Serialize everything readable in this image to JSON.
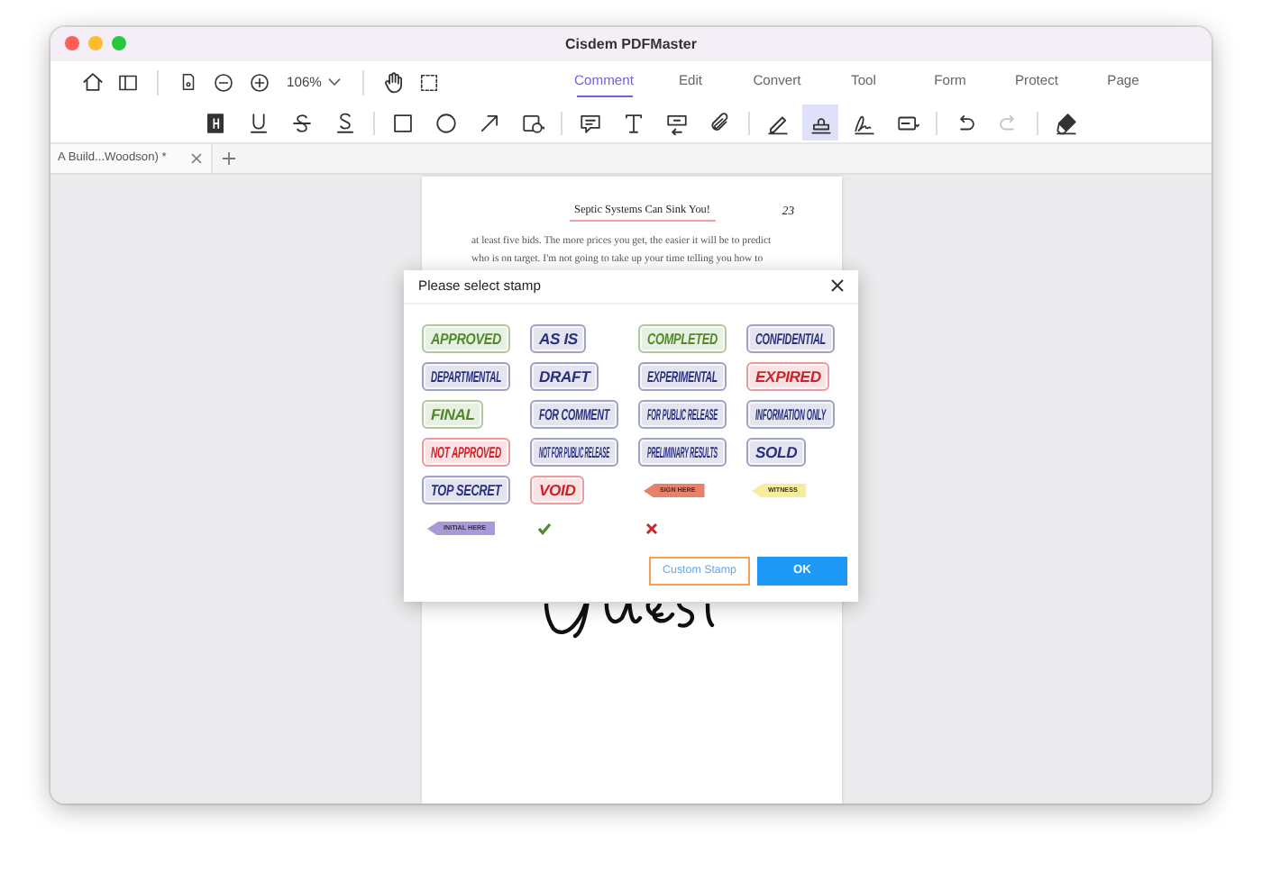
{
  "window": {
    "title": "Cisdem PDFMaster"
  },
  "toolbar": {
    "zoom": "106%",
    "tabs": [
      {
        "label": "Comment",
        "selected": true
      },
      {
        "label": "Edit",
        "selected": false
      },
      {
        "label": "Convert",
        "selected": false
      },
      {
        "label": "Tool",
        "selected": false
      },
      {
        "label": "Form",
        "selected": false
      },
      {
        "label": "Protect",
        "selected": false
      },
      {
        "label": "Page",
        "selected": false
      }
    ]
  },
  "annotation_tools": [
    [
      {
        "kind": "highlight",
        "selected": false,
        "disabled": false
      },
      {
        "kind": "underline",
        "selected": false,
        "disabled": false
      },
      {
        "kind": "strikethrough",
        "selected": false,
        "disabled": false
      },
      {
        "kind": "squiggly",
        "selected": false,
        "disabled": false
      }
    ],
    [
      {
        "kind": "rectangle",
        "selected": false,
        "disabled": false
      },
      {
        "kind": "circle",
        "selected": false,
        "disabled": false
      },
      {
        "kind": "arrow",
        "selected": false,
        "disabled": false
      },
      {
        "kind": "shape",
        "selected": false,
        "disabled": false
      }
    ],
    [
      {
        "kind": "note",
        "selected": false,
        "disabled": false
      },
      {
        "kind": "text",
        "selected": false,
        "disabled": false
      },
      {
        "kind": "textbox",
        "selected": false,
        "disabled": false
      },
      {
        "kind": "attachment",
        "selected": false,
        "disabled": false
      }
    ],
    [
      {
        "kind": "pen",
        "selected": false,
        "disabled": false
      },
      {
        "kind": "stamp",
        "selected": true,
        "disabled": false
      },
      {
        "kind": "signature",
        "selected": false,
        "disabled": false
      },
      {
        "kind": "field",
        "selected": false,
        "disabled": false
      }
    ],
    [
      {
        "kind": "undo",
        "selected": false,
        "disabled": false
      },
      {
        "kind": "redo",
        "selected": false,
        "disabled": true
      }
    ],
    [
      {
        "kind": "eraser",
        "selected": false,
        "disabled": false
      }
    ]
  ],
  "document_tabs": [
    {
      "label": "A Build...Woodson) *"
    }
  ],
  "page": {
    "header": "Septic Systems Can Sink You!",
    "page_number": "23",
    "lines": [
      "at least five bids. The more prices you get, the easier it will be to predict",
      "who is on target. I'm not going to take up your time telling you how to"
    ]
  },
  "dialog": {
    "title": "Please select stamp",
    "stamps": [
      {
        "kind": "label",
        "label": "APPROVED",
        "color": "#4f8a2b"
      },
      {
        "kind": "label",
        "label": "AS IS",
        "color": "#283080"
      },
      {
        "kind": "label",
        "label": "COMPLETED",
        "color": "#4f8a2b"
      },
      {
        "kind": "label",
        "label": "CONFIDENTIAL",
        "color": "#283080"
      },
      {
        "kind": "label",
        "label": "DEPARTMENTAL",
        "color": "#283080"
      },
      {
        "kind": "label",
        "label": "DRAFT",
        "color": "#283080"
      },
      {
        "kind": "label",
        "label": "EXPERIMENTAL",
        "color": "#283080"
      },
      {
        "kind": "label",
        "label": "EXPIRED",
        "color": "#d21f26"
      },
      {
        "kind": "label",
        "label": "FINAL",
        "color": "#4f8a2b"
      },
      {
        "kind": "label",
        "label": "FOR COMMENT",
        "color": "#283080"
      },
      {
        "kind": "label",
        "label": "FOR PUBLIC RELEASE",
        "color": "#283080"
      },
      {
        "kind": "label",
        "label": "INFORMATION ONLY",
        "color": "#283080"
      },
      {
        "kind": "label",
        "label": "NOT APPROVED",
        "color": "#d21f26"
      },
      {
        "kind": "label",
        "label": "NOT FOR PUBLIC RELEASE",
        "color": "#283080"
      },
      {
        "kind": "label",
        "label": "PRELIMINARY RESULTS",
        "color": "#283080"
      },
      {
        "kind": "label",
        "label": "SOLD",
        "color": "#283080"
      },
      {
        "kind": "label",
        "label": "TOP SECRET",
        "color": "#283080"
      },
      {
        "kind": "label",
        "label": "VOID",
        "color": "#d21f26"
      },
      {
        "kind": "tag",
        "label": "SIGN HERE",
        "color": "#e8806a"
      },
      {
        "kind": "tag",
        "label": "WITNESS",
        "color": "#f6ee9c"
      },
      {
        "kind": "tag",
        "label": "INITIAL HERE",
        "color": "#a79ad6"
      },
      {
        "kind": "check",
        "color": "#4f8a2b"
      },
      {
        "kind": "cross",
        "color": "#c8282a"
      }
    ],
    "buttons": [
      {
        "kind": "secondary",
        "label": "Custom Stamp"
      },
      {
        "kind": "primary",
        "label": "OK"
      }
    ]
  }
}
